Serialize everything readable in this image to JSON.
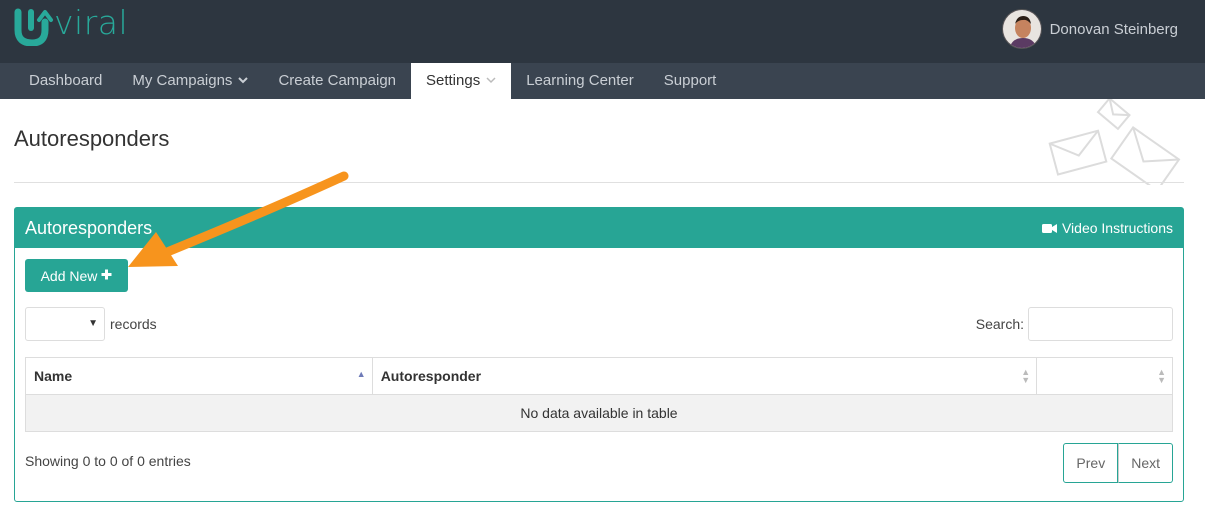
{
  "brand": {
    "logo_text": "viral",
    "accent_color": "#27a595"
  },
  "user": {
    "name": "Donovan Steinberg"
  },
  "nav": {
    "items": [
      {
        "label": "Dashboard"
      },
      {
        "label": "My Campaigns",
        "caret": "⌄"
      },
      {
        "label": "Create Campaign"
      },
      {
        "label": "Settings",
        "caret": "⌄",
        "active": true
      },
      {
        "label": "Learning Center"
      },
      {
        "label": "Support"
      }
    ]
  },
  "page": {
    "title": "Autoresponders"
  },
  "panel": {
    "title": "Autoresponders",
    "video_label": "Video Instructions",
    "video_icon": "video-camera-icon",
    "add_button": "Add New",
    "add_icon": "✚",
    "length_label": "records",
    "length_value": "",
    "search_label": "Search:",
    "search_value": "",
    "table": {
      "columns": [
        "Name",
        "Autoresponder",
        ""
      ],
      "empty_message": "No data available in table"
    },
    "info": "Showing 0 to 0 of 0 entries",
    "pager": {
      "prev": "Prev",
      "next": "Next"
    }
  },
  "annotation": {
    "arrow_color": "#f7941d"
  }
}
